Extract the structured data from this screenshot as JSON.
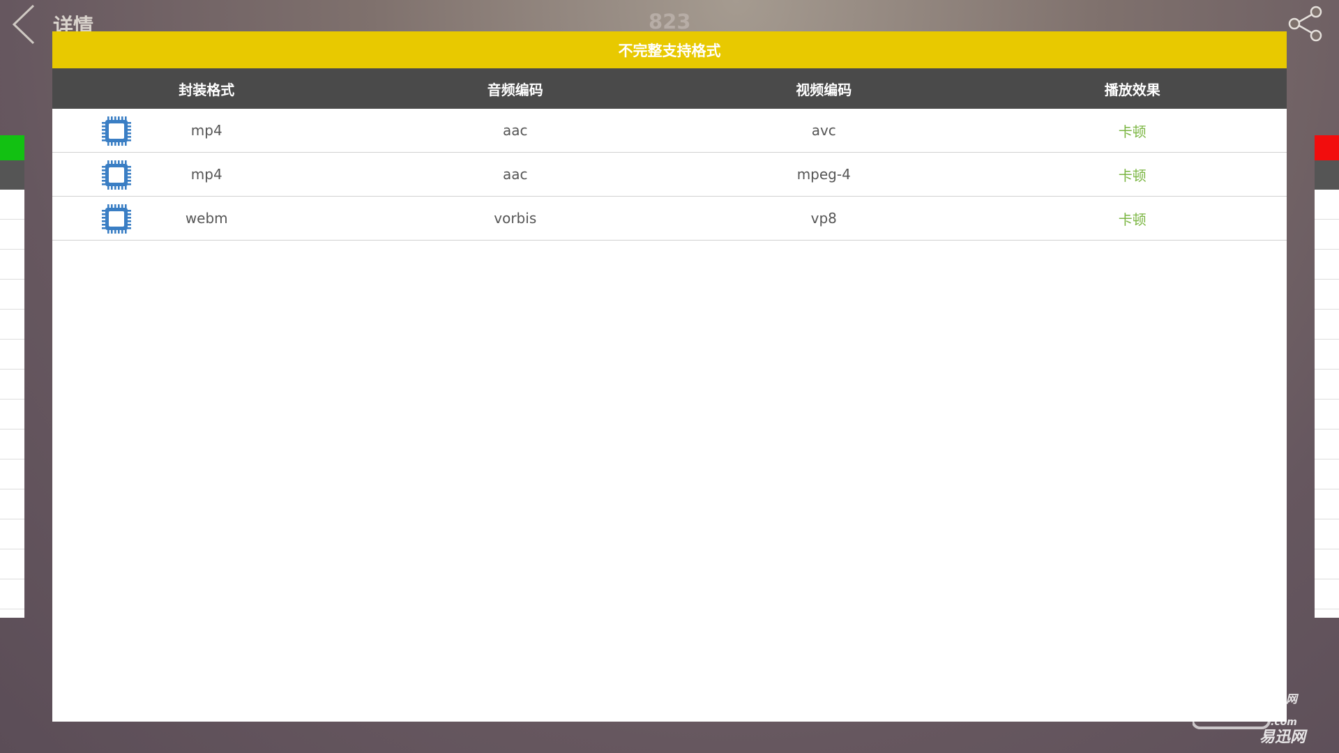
{
  "topbar": {
    "back_icon": "chevron-left-icon",
    "title": "详情",
    "score": "823",
    "share_icon": "share-icon"
  },
  "side_indicators": {
    "left_color": "#12c112",
    "right_color": "#f20d0d"
  },
  "dialog": {
    "title": "不完整支持格式",
    "header_color": "#e8c900",
    "columns": [
      "封装格式",
      "音频编码",
      "视频编码",
      "播放效果"
    ],
    "row_icon": "chip-icon",
    "rows": [
      {
        "container": "mp4",
        "audio": "aac",
        "video": "avc",
        "result": "卡顿"
      },
      {
        "container": "mp4",
        "audio": "aac",
        "video": "mpeg-4",
        "result": "卡顿"
      },
      {
        "container": "webm",
        "audio": "vorbis",
        "video": "vp8",
        "result": "卡顿"
      }
    ]
  },
  "watermark": {
    "text": "易迅网",
    "suffix": ".com",
    "corner": "网"
  }
}
